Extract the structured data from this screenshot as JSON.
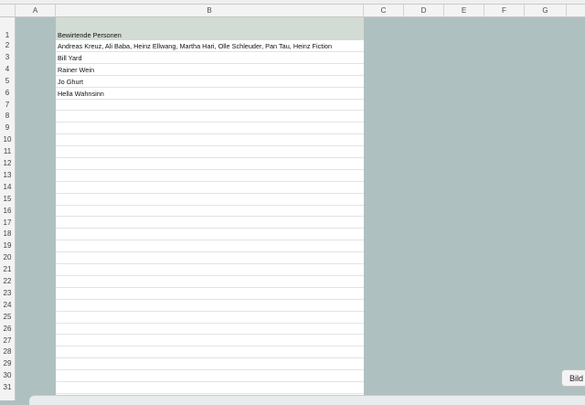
{
  "columns": [
    "A",
    "B",
    "C",
    "D",
    "E",
    "F",
    "G"
  ],
  "rows": [
    "1",
    "2",
    "3",
    "4",
    "5",
    "6",
    "7",
    "8",
    "9",
    "10",
    "11",
    "12",
    "13",
    "14",
    "15",
    "16",
    "17",
    "18",
    "19",
    "20",
    "21",
    "22",
    "23",
    "24",
    "25",
    "26",
    "27",
    "28",
    "29",
    "30",
    "31"
  ],
  "cells": {
    "b1": "Bewirtende Personen",
    "b2": "Andreas Kreuz, Ali Baba, Heinz Ellwang, Martha Hari, Olle Schleuder, Pan Tau, Heinz Fiction",
    "b3": "Bill Yard",
    "b4": "Rainer Wein",
    "b5": "Jo Ghurt",
    "b6": "Hella Wahnsinn"
  },
  "partial_button_label": "Bild",
  "colors": {
    "background": "#afc0c0",
    "header_fill": "#d3dbd5",
    "cell_fill": "#ffffff"
  }
}
